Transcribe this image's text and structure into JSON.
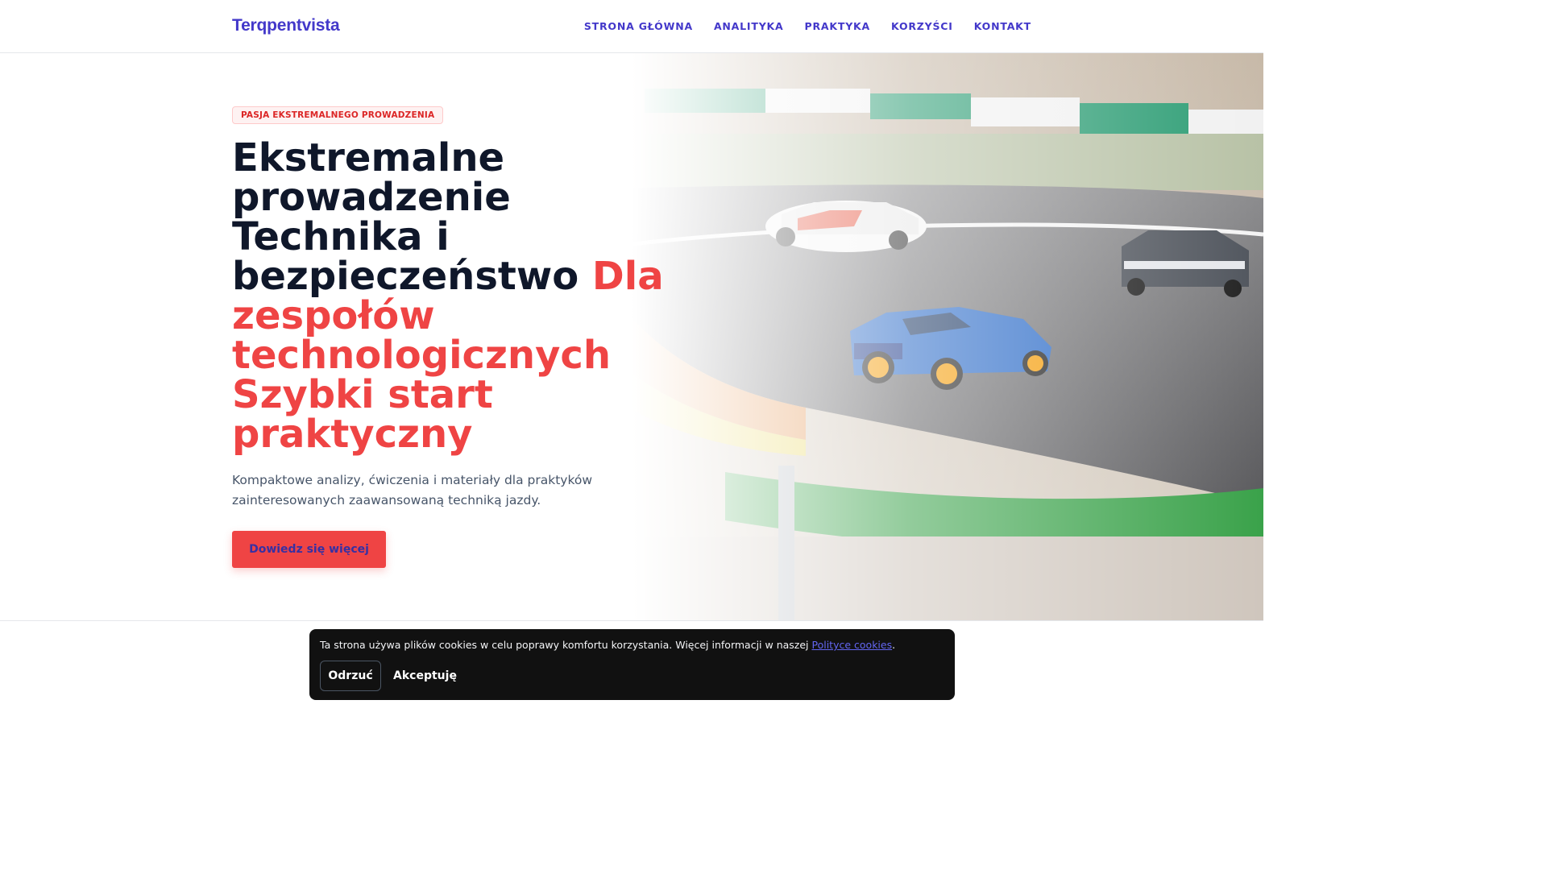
{
  "brand": {
    "name": "Terqpentvista"
  },
  "nav": {
    "items": [
      {
        "label": "STRONA GŁÓWNA"
      },
      {
        "label": "ANALITYKA"
      },
      {
        "label": "PRAKTYKA"
      },
      {
        "label": "KORZYŚCI"
      },
      {
        "label": "KONTAKT"
      }
    ]
  },
  "hero": {
    "badge": "PASJA EKSTREMALNEGO PROWADZENIA",
    "headline_main": "Ekstremalne prowadzenie Technika i bezpieczeństwo",
    "headline_accent": "Dla zespołów technologicznych Szybki start praktyczny",
    "lead": "Kompaktowe analizy, ćwiczenia i materiały dla praktyków zainteresowanych zaawansowaną techniką jazdy.",
    "cta_label": "Dowiedz się więcej",
    "image_icon": "race-track-photo"
  },
  "cookie": {
    "text_before": "Ta strona używa plików cookies w celu poprawy komfortu korzystania. Więcej informacji w naszej ",
    "link_text": "Polityce cookies",
    "text_after": ".",
    "reject_label": "Odrzuć",
    "accept_label": "Akceptuję"
  },
  "colors": {
    "brand": "#4338ca",
    "accent": "#ef4444",
    "cookie_bg": "#111111"
  }
}
